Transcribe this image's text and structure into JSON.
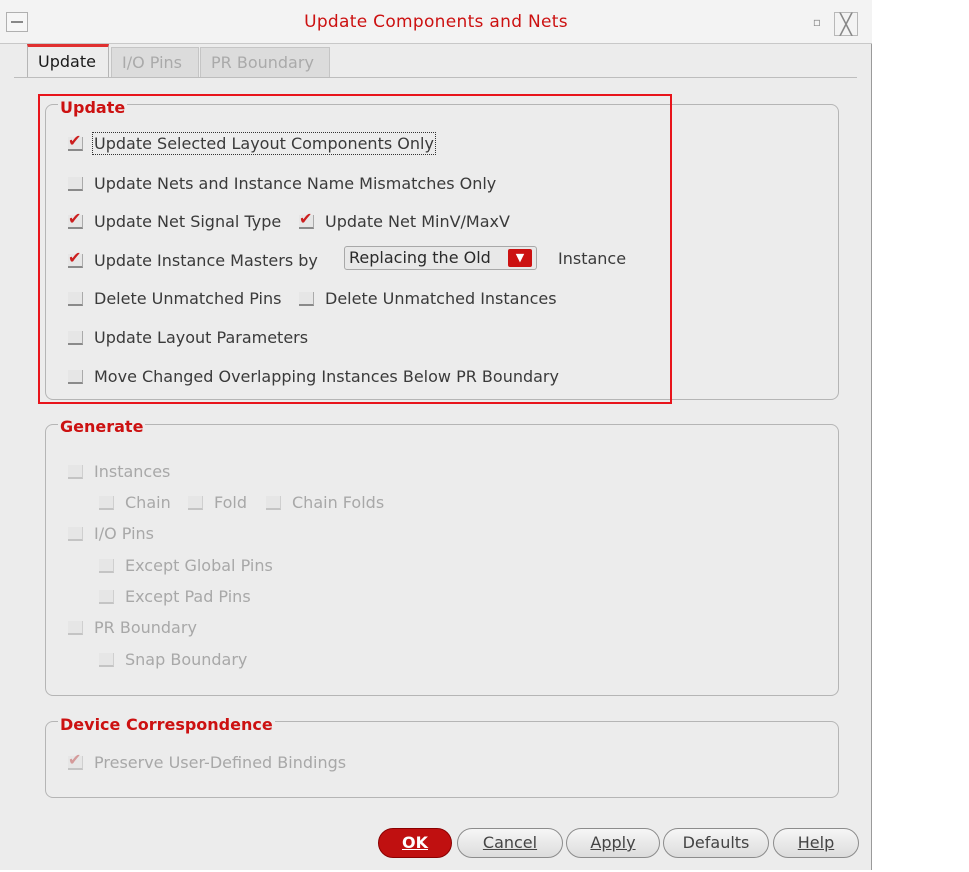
{
  "window": {
    "title": "Update Components and Nets"
  },
  "tabs": [
    {
      "label": "Update"
    },
    {
      "label": "I/O Pins"
    },
    {
      "label": "PR Boundary"
    }
  ],
  "update": {
    "title": "Update",
    "items": {
      "selected_only": {
        "label": "Update Selected Layout Components Only",
        "checked": true
      },
      "name_mismatch": {
        "label": "Update Nets and Instance Name Mismatches Only",
        "checked": false
      },
      "net_signal": {
        "label": "Update Net Signal Type",
        "checked": true
      },
      "net_minmax": {
        "label": "Update Net MinV/MaxV",
        "checked": true
      },
      "inst_masters": {
        "label": "Update Instance Masters by",
        "checked": true
      },
      "del_pins": {
        "label": "Delete Unmatched Pins",
        "checked": false
      },
      "del_inst": {
        "label": "Delete Unmatched Instances",
        "checked": false
      },
      "layout_params": {
        "label": "Update Layout Parameters",
        "checked": false
      },
      "move_overlap": {
        "label": "Move Changed Overlapping Instances Below PR Boundary",
        "checked": false
      }
    },
    "masters_select": {
      "value": "Replacing the Old",
      "suffix": "Instance"
    }
  },
  "generate": {
    "title": "Generate",
    "instances": "Instances",
    "chain": "Chain",
    "fold": "Fold",
    "chain_folds": "Chain Folds",
    "io_pins": "I/O Pins",
    "except_global": "Except Global Pins",
    "except_pad": "Except Pad Pins",
    "pr_boundary": "PR Boundary",
    "snap_boundary": "Snap Boundary"
  },
  "device": {
    "title": "Device Correspondence",
    "preserve": {
      "label": "Preserve User-Defined Bindings",
      "checked": true
    }
  },
  "buttons": {
    "ok": "OK",
    "cancel": "Cancel",
    "apply": "Apply",
    "defaults": "Defaults",
    "help": "Help"
  },
  "colors": {
    "accent": "#cc1111",
    "highlight": "#e8141b"
  }
}
